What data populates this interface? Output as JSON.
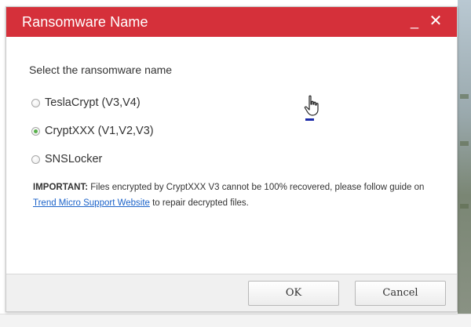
{
  "window": {
    "title": "Ransomware Name",
    "minimize_label": "_",
    "close_label": "✕"
  },
  "content": {
    "prompt": "Select the ransomware name",
    "options": [
      {
        "label": "TeslaCrypt (V3,V4)",
        "selected": false
      },
      {
        "label": "CryptXXX (V1,V2,V3)",
        "selected": true
      },
      {
        "label": "SNSLocker",
        "selected": false
      }
    ],
    "notice": {
      "important_label": "IMPORTANT:",
      "text_before": " Files encrypted by CryptXXX V3 cannot be 100% recovered, please follow guide on ",
      "link_text": "Trend Micro Support Website",
      "text_after": " to repair decrypted files."
    }
  },
  "footer": {
    "ok_label": "OK",
    "cancel_label": "Cancel"
  },
  "colors": {
    "titlebar": "#d5303a",
    "link": "#1c63c9",
    "radio_selected": "#58b04b"
  }
}
